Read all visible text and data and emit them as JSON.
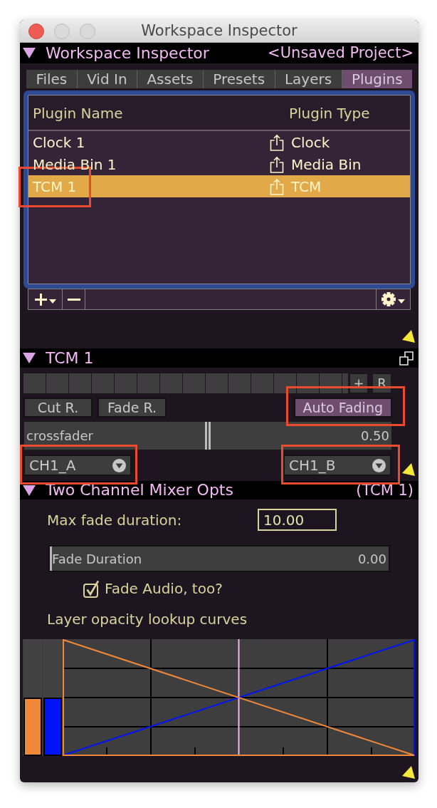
{
  "window": {
    "title": "Workspace Inspector"
  },
  "workspace_section": {
    "title": "Workspace Inspector",
    "project": "<Unsaved Project>",
    "expanded": true,
    "tabs": [
      {
        "label": "Files",
        "selected": false
      },
      {
        "label": "Vid In",
        "selected": false
      },
      {
        "label": "Assets",
        "selected": false
      },
      {
        "label": "Presets",
        "selected": false
      },
      {
        "label": "Layers",
        "selected": false
      },
      {
        "label": "Plugins",
        "selected": true
      }
    ],
    "plugin_table": {
      "columns": [
        "Plugin Name",
        "Plugin Type"
      ],
      "rows": [
        {
          "name": "Clock 1",
          "type": "Clock",
          "selected": false,
          "highlighted": false
        },
        {
          "name": "Media Bin 1",
          "type": "Media Bin",
          "selected": false,
          "highlighted": false
        },
        {
          "name": "TCM 1",
          "type": "TCM",
          "selected": true,
          "highlighted": true
        }
      ]
    }
  },
  "tcm_section": {
    "title": "TCM 1",
    "expanded": true,
    "slot_buttons": [
      "+",
      "R"
    ],
    "buttons": [
      {
        "label": "Cut R.",
        "on": false,
        "highlighted": false
      },
      {
        "label": "Fade R.",
        "on": false,
        "highlighted": false
      },
      {
        "label": "Auto Fading",
        "on": true,
        "highlighted": true
      }
    ],
    "crossfader": {
      "label": "crossfader",
      "level": 0.5,
      "reading": "0.50"
    },
    "channel_menus": [
      {
        "value": "CH1_A",
        "highlighted": true
      },
      {
        "value": "CH1_B",
        "highlighted": true
      }
    ]
  },
  "mixer_section": {
    "title": "Two Channel Mixer Opts",
    "target": "(TCM 1)",
    "expanded": true,
    "max_fade": {
      "label": "Max fade duration:",
      "value": "10.00"
    },
    "fade_duration": {
      "label": "Fade Duration",
      "level": 0,
      "reading": "0.00"
    },
    "fade_audio": {
      "label": "Fade Audio, too?",
      "checked": true
    },
    "curves_label": "Layer opacity lookup curves",
    "curves": [
      {
        "kind": "falling",
        "color": "#f0883a",
        "level": 0.5
      },
      {
        "kind": "rising",
        "color": "#0014f5",
        "level": 0.5
      }
    ]
  }
}
